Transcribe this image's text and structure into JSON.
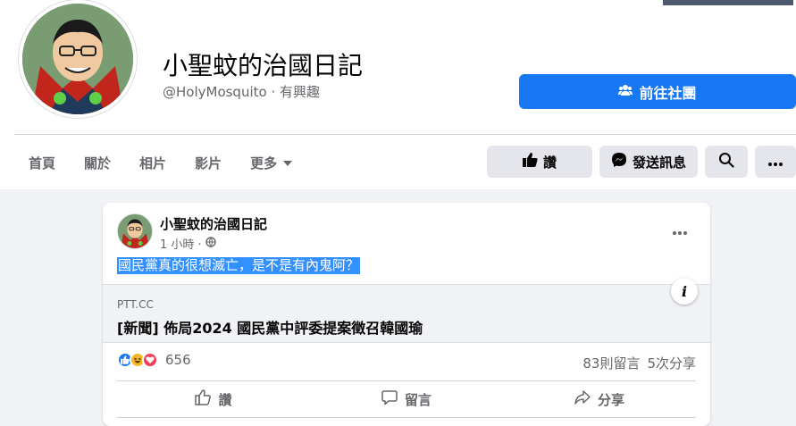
{
  "page": {
    "name": "小聖蚊的治國日記",
    "handle": "@HolyMosquito",
    "category": "· 有興趣",
    "group_button": "前往社團"
  },
  "tabs": [
    "首頁",
    "關於",
    "相片",
    "影片",
    "更多"
  ],
  "actions": {
    "like": "讚",
    "message": "發送訊息"
  },
  "post": {
    "author": "小聖蚊的治國日記",
    "time": "1 小時 ·",
    "text": "國民黨真的很想滅亡，是不是有內鬼阿？",
    "link": {
      "domain": "PTT.CC",
      "title": "[新聞] 佈局2024 國民黨中評委提案徵召韓國瑜"
    },
    "reaction_count": "656",
    "comments": "83則留言",
    "shares": "5次分享",
    "buttons": {
      "like": "讚",
      "comment": "留言",
      "share": "分享"
    }
  },
  "colors": {
    "primary": "#1877f2",
    "secondary_text": "#65676b",
    "button_gray": "#e4e6eb",
    "background": "#f0f2f5",
    "selection": "#3390ff"
  }
}
